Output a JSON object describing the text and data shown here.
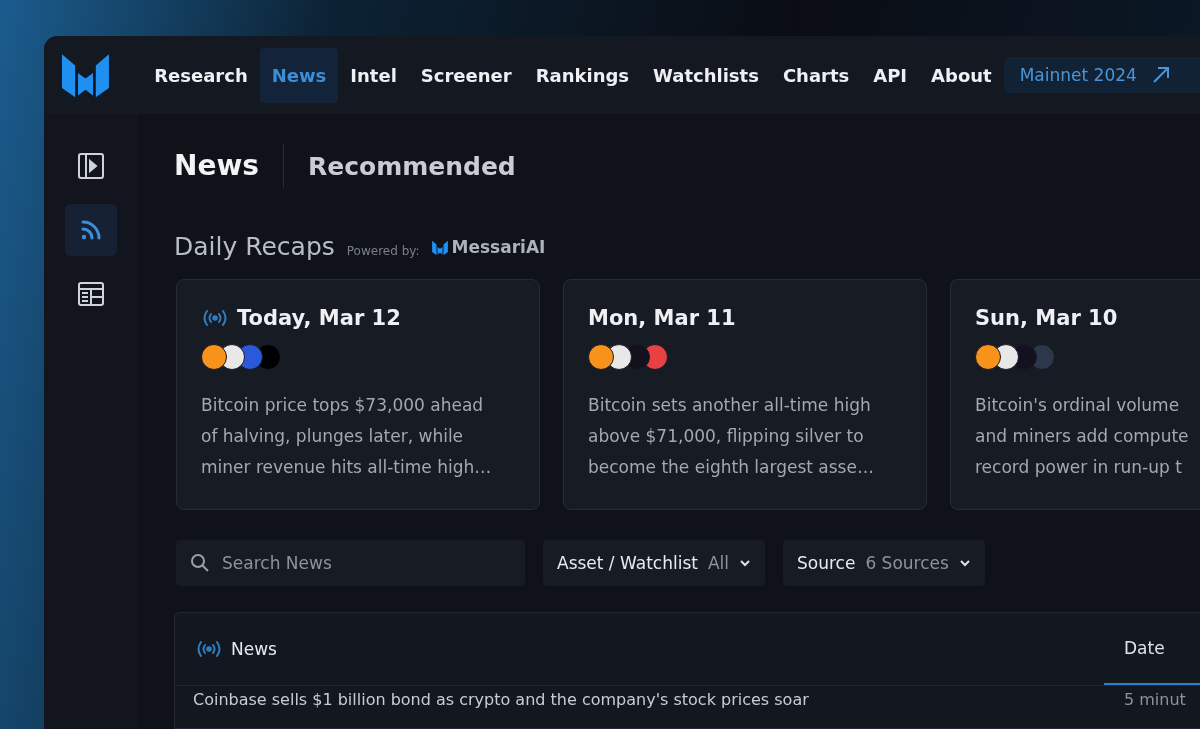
{
  "nav": {
    "items": [
      {
        "label": "Research",
        "selected": false
      },
      {
        "label": "News",
        "selected": true
      },
      {
        "label": "Intel",
        "selected": false
      },
      {
        "label": "Screener",
        "selected": false
      },
      {
        "label": "Rankings",
        "selected": false
      },
      {
        "label": "Watchlists",
        "selected": false
      },
      {
        "label": "Charts",
        "selected": false
      },
      {
        "label": "API",
        "selected": false
      },
      {
        "label": "About",
        "selected": false
      }
    ],
    "cta": "Mainnet 2024"
  },
  "sidebar": {
    "items": [
      {
        "kind": "panel",
        "selected": false
      },
      {
        "kind": "feed",
        "selected": true
      },
      {
        "kind": "calendar",
        "selected": false
      }
    ]
  },
  "header": {
    "title": "News",
    "tab": "Recommended"
  },
  "recaps": {
    "title": "Daily Recaps",
    "powered_by": "Powered by:",
    "brand": "MessariAI",
    "cards": [
      {
        "date": "Today, Mar 12",
        "live": true,
        "coins": [
          {
            "color": "#f7931a"
          },
          {
            "color": "#e8e8e8"
          },
          {
            "color": "#2a5ada"
          },
          {
            "color": "#000000"
          }
        ],
        "lines": [
          "Bitcoin price tops $73,000 ahead",
          "of halving, plunges later, while",
          "miner revenue hits all-time high…"
        ]
      },
      {
        "date": "Mon, Mar 11",
        "live": false,
        "coins": [
          {
            "color": "#f7931a"
          },
          {
            "color": "#e8e8e8"
          },
          {
            "color": "#14111f"
          },
          {
            "color": "#e84142"
          }
        ],
        "lines": [
          "Bitcoin sets another all-time high",
          "above $71,000, flipping silver to",
          "become the eighth largest asse…"
        ]
      },
      {
        "date": "Sun, Mar 10",
        "live": false,
        "coins": [
          {
            "color": "#f7931a"
          },
          {
            "color": "#e8e8e8"
          },
          {
            "color": "#14111f"
          },
          {
            "color": "#2d374b"
          }
        ],
        "lines": [
          "Bitcoin's ordinal volume",
          "and miners add compute",
          "record power in run-up t"
        ]
      }
    ]
  },
  "filters": {
    "search": {
      "placeholder": "Search News"
    },
    "dropdowns": [
      {
        "label": "Asset / Watchlist",
        "value": "All"
      },
      {
        "label": "Source",
        "value": "6 Sources"
      }
    ]
  },
  "table": {
    "title": "News",
    "date_column": {
      "label": "Date",
      "selected": true
    },
    "rows": [
      {
        "title": "Coinbase sells $1 billion bond as crypto and the company's stock prices soar",
        "date": "5 minut"
      }
    ]
  }
}
